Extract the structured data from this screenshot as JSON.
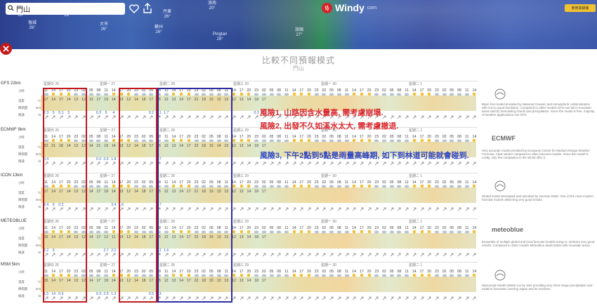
{
  "search": {
    "value": "門山"
  },
  "logo": {
    "brand": "Windy",
    "suffix": "com"
  },
  "premium": {
    "label": "使用高級版"
  },
  "map_labels": [
    {
      "name": "海州",
      "temp": "26°"
    },
    {
      "name": "塩城",
      "temp": "26°"
    },
    {
      "name": "東台",
      "temp": "26°"
    },
    {
      "name": "大市",
      "temp": "26°"
    },
    {
      "name": "蘇州",
      "temp": "26°"
    },
    {
      "name": "丹東",
      "temp": "26°"
    },
    {
      "name": "濟南",
      "temp": "20°"
    },
    {
      "name": "Pingtan",
      "temp": "26°"
    },
    {
      "name": "旅順",
      "temp": "27°"
    }
  ],
  "panel": {
    "title": "比較不同預報模式",
    "subtitle": "門山"
  },
  "row_labels": {
    "hour": "小時",
    "temp": "溫度",
    "temp_unit": "°C",
    "rain": "降雨量",
    "rain_unit": "mm",
    "wind": "風速",
    "wind_unit": "kt"
  },
  "dates": [
    "星期日 26",
    "星期一 27",
    "星期二 28",
    "星期三 29",
    "星期一 30",
    "星期二 1"
  ],
  "hours_cycle": [
    "11",
    "14",
    "17",
    "20",
    "23",
    "02",
    "05",
    "08"
  ],
  "models": [
    {
      "name": "GFS 22km",
      "logo": "",
      "desc": "Basic free model provided by National Oceanic and Atmospheric Administration with not so good resolution. Compared to other models GFS can fail in mountain areas and by forecasting clouds and precipitation. Since the model is free, majority of weather applications use GFS.",
      "temps": [
        "17",
        "14",
        "17",
        "14",
        "13",
        "12",
        "13",
        "17",
        "19",
        "14",
        "13",
        "12",
        "14",
        "18",
        "17",
        "15",
        "12",
        "13",
        "14",
        "17",
        "21",
        "18",
        "15",
        "13",
        "13",
        "12",
        "13",
        "14",
        "18",
        "17"
      ],
      "rain": [
        "2.3",
        "5",
        "5.1",
        "3",
        "",
        "",
        "",
        "0.3",
        "5",
        "4",
        "",
        "",
        "",
        "",
        "0.2",
        "3.1",
        "1.7",
        "",
        "",
        "",
        "",
        "",
        "",
        "",
        "",
        "",
        "",
        "",
        "0.3",
        "2.2"
      ]
    },
    {
      "name": "ECMWF 9km",
      "logo": "ECMWF",
      "desc": "Very accurate model provided by European Centre for Medium-Range Weather Forecast. Clear winner compared to other forecast models. Since the model is costly, only few companies in the World offer it.",
      "temps": [
        "22",
        "21",
        "18",
        "14",
        "13",
        "12",
        "14",
        "21",
        "19",
        "14",
        "13",
        "12",
        "14",
        "18",
        "17",
        "15",
        "12",
        "13",
        "14",
        "17",
        "22",
        "18",
        "15",
        "14",
        "13",
        "12",
        "13",
        "14",
        "18",
        "17"
      ],
      "rain": [
        "0.4",
        "",
        "",
        "",
        "",
        "",
        "",
        "0.3",
        "0.5",
        "1.8",
        "",
        "",
        "",
        "",
        "",
        "1.7",
        "",
        "",
        "",
        "",
        "",
        "",
        "",
        "",
        "",
        "",
        "",
        "",
        "",
        ""
      ]
    },
    {
      "name": "ICON 13km",
      "logo": "",
      "desc": "Global model developed and operated by German DWD. One of the most modern forecast models delivering very good results.",
      "temps": [
        "17",
        "14",
        "17",
        "14",
        "13",
        "12",
        "14",
        "17",
        "19",
        "14",
        "13",
        "12",
        "14",
        "18",
        "17",
        "15",
        "12",
        "13",
        "14",
        "17",
        "21",
        "18",
        "15",
        "13",
        "13",
        "12",
        "13",
        "14",
        "18",
        "17"
      ],
      "rain": [
        "3.4",
        "9",
        "0.2",
        "",
        "",
        "",
        "",
        "",
        "",
        "3.4",
        "1.6",
        "",
        "",
        "",
        "",
        "1.7",
        "",
        "",
        "",
        "",
        "",
        "",
        "",
        "",
        "",
        "",
        "",
        "",
        "",
        ""
      ]
    },
    {
      "name": "METEOBLUE",
      "logo": "meteoblue",
      "desc": "Ensemble of multiple global and local forecast models using AI. Delivers very good results. Compared to other models Meteoblue deals better with mountain areas.",
      "temps": [
        "15",
        "14",
        "17",
        "14",
        "13",
        "12",
        "14",
        "17",
        "12",
        "11",
        "13",
        "12",
        "14",
        "18",
        "17",
        "15",
        "12",
        "13",
        "14",
        "17",
        "22",
        "18",
        "15",
        "13",
        "13",
        "12",
        "13",
        "14",
        "18",
        "17"
      ],
      "rain": [
        "3.2",
        "5",
        "",
        "",
        "",
        "",
        "",
        "",
        "2.7",
        "2.2",
        "",
        "",
        "",
        "",
        "",
        "3.2",
        "1.6",
        "",
        "",
        "",
        "",
        "",
        "",
        "",
        "",
        "",
        "",
        "",
        "",
        ""
      ]
    },
    {
      "name": "MSM 5km",
      "logo": "",
      "desc": "Mesoscale Model (MSM) run by JMA providing very short-range precipitation and aviation forecasts covering Japan and its environs.",
      "temps": [
        "15",
        "14",
        "17",
        "14",
        "13",
        "12",
        "14",
        "17",
        "19",
        "14",
        "13",
        "12",
        "14",
        "18",
        "17",
        "15",
        "12",
        "13",
        "14",
        "17",
        "22",
        "18",
        "15",
        "13",
        "13",
        "12",
        "13",
        "14",
        "18",
        "17"
      ],
      "rain": [
        "1.5",
        "14",
        "0.5",
        "",
        "",
        "",
        "",
        "0.3",
        "2.5",
        "1.3",
        "",
        "",
        "",
        "",
        "0.5",
        "0.3",
        "",
        "",
        "",
        "",
        "",
        "",
        "",
        "",
        "",
        "",
        "",
        "",
        "",
        ""
      ]
    }
  ],
  "notes": [
    {
      "text": "風險1, 山路因含水量高, 需考慮崩塌.",
      "color": "red"
    },
    {
      "text": "風險2, 出發不久如溪水太大, 需考慮撤退.",
      "color": "red"
    },
    {
      "text": "風險3, 下午2點到5點是雨量高峰期, 如下到林道可能就會碰到.",
      "color": "blue"
    }
  ],
  "colors": {
    "accent_red": "#c0181c",
    "accent_blue": "#2f2ca3",
    "windy_red": "#d4242a"
  }
}
